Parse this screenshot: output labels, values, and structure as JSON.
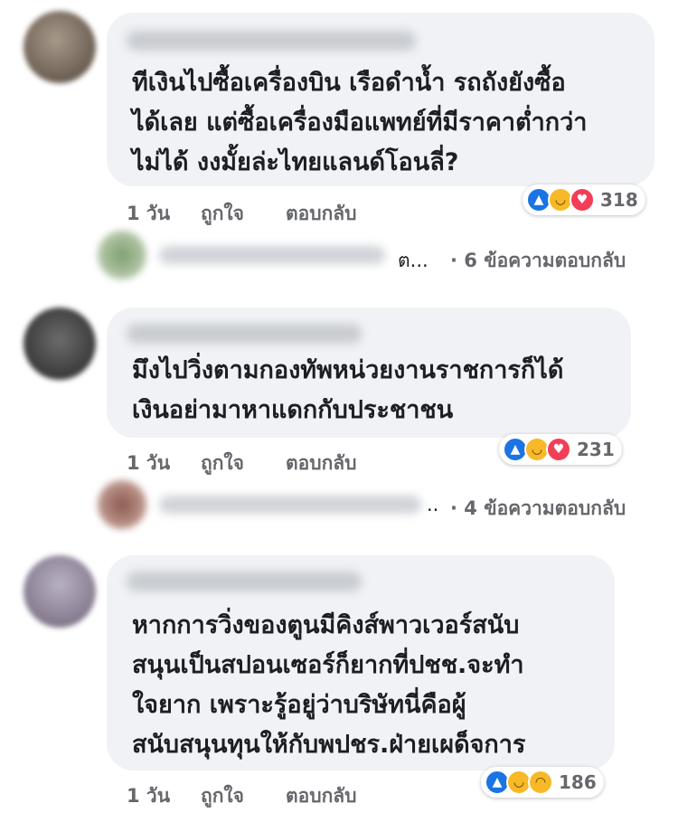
{
  "comments": [
    {
      "lines": [
        "ทีเงินไปซื้อเครื่องบิน เรือดำน้ำ รถถังยังซื้อ",
        "ได้เลย แต่ซื้อเครื่องมือแพทย์ที่มีราคาต่ำกว่า",
        "ไม่ได้ งงมั้ยล่ะไทยแลนด์โอนลี่?"
      ],
      "time": "1 วัน",
      "like": "ถูกใจ",
      "reply": "ตอบกลับ",
      "reaction_count": "318",
      "reactions": [
        "like-icon",
        "haha-icon",
        "love-icon"
      ],
      "replies_prefix": "ต...",
      "replies_label": "· 6 ข้อความตอบกลับ"
    },
    {
      "lines": [
        "มึงไปวิ่งตามกองทัพหน่วยงานราชการก็ได้",
        "เงินอย่ามาหาแดกกับประชาชน"
      ],
      "time": "1 วัน",
      "like": "ถูกใจ",
      "reply": "ตอบกลับ",
      "reaction_count": "231",
      "reactions": [
        "like-icon",
        "haha-icon",
        "love-icon"
      ],
      "replies_prefix": "..",
      "replies_label": "· 4 ข้อความตอบกลับ"
    },
    {
      "lines": [
        "หากการวิ่งของตูนมีคิงส์พาวเวอร์สนับ",
        "สนุนเป็นสปอนเซอร์ก็ยากที่ปชช.จะทำ",
        "ใจยาก เพราะรู้อยู่ว่าบริษัทนี่คือผู้",
        "สนับสนุนทุนให้กับพปชร.ฝ่ายเผด็จการ"
      ],
      "time": "1 วัน",
      "like": "ถูกใจ",
      "reply": "ตอบกลับ",
      "reaction_count": "186",
      "reactions": [
        "like-icon",
        "haha-icon",
        "sad-icon"
      ]
    }
  ],
  "colors": {
    "like": "#1b74e4",
    "haha": "#f7b928",
    "love": "#f33e58",
    "bubble": "#f0f2f5",
    "meta": "#65676b"
  }
}
